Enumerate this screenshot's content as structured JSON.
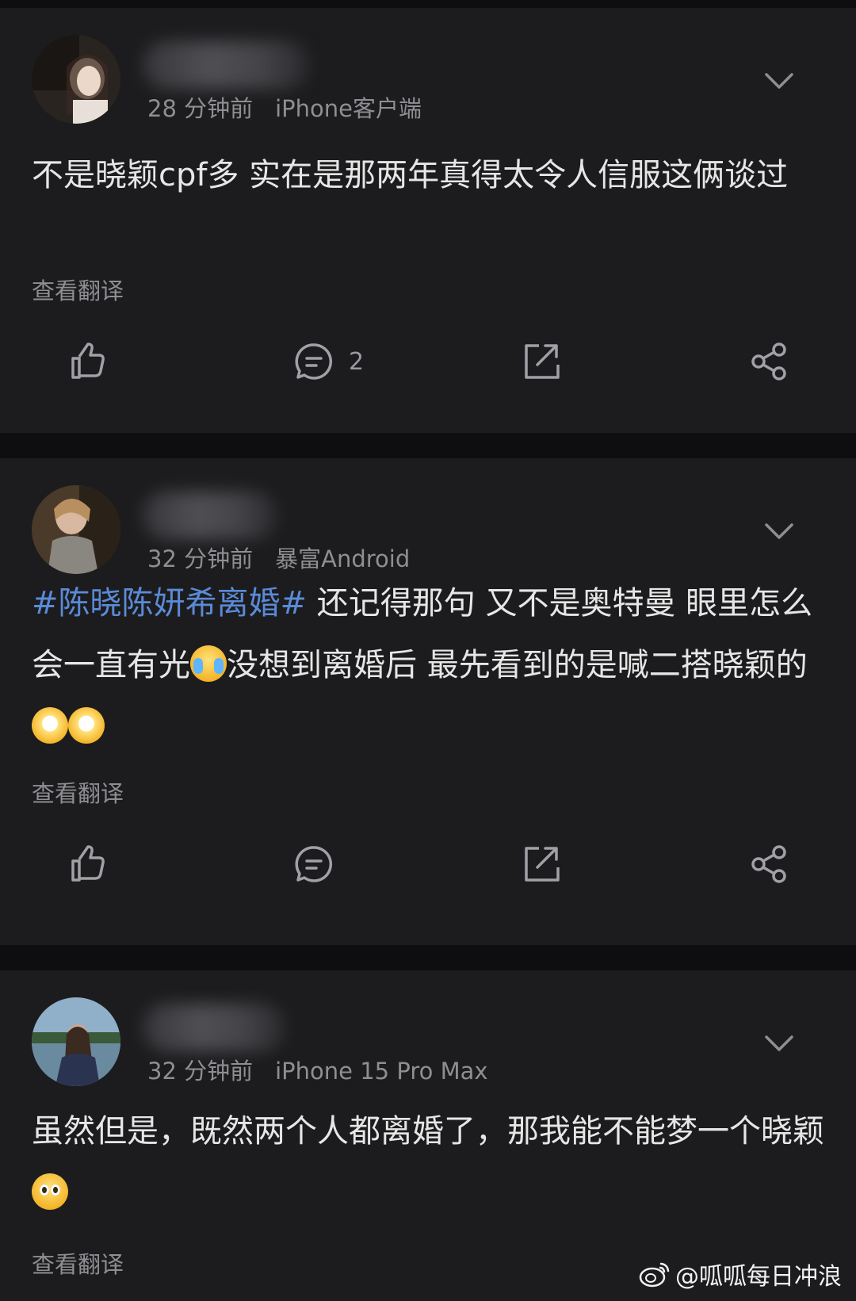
{
  "comments": [
    {
      "time": "28 分钟前",
      "device": "iPhone客户端",
      "text": "不是晓颖cpf多 实在是那两年真得太令人信服这俩谈过",
      "translate": "查看翻译",
      "comment_count": "2"
    },
    {
      "time": "32 分钟前",
      "device": "暴富Android",
      "topic": "#陈晓陈妍希离婚#",
      "text_a": " 还记得那句 又不是奥特曼 眼里怎么会一直有光",
      "text_b": "没想到离婚后 最先看到的是喊二搭晓颖的",
      "translate": "查看翻译",
      "comment_count": ""
    },
    {
      "time": "32 分钟前",
      "device": "iPhone 15 Pro Max",
      "text": "虽然但是，既然两个人都离婚了，那我能不能梦一个晓颖",
      "translate": "查看翻译"
    }
  ],
  "icons": [
    "like-icon",
    "comment-icon",
    "repost-icon",
    "share-icon",
    "chevron-down-icon",
    "weibo-logo-icon"
  ],
  "watermark": "@呱呱每日冲浪",
  "colors": {
    "background": "#0e0e10",
    "card": "#1c1c1e",
    "topic": "#5b8ad6",
    "meta": "#8e8e93"
  }
}
